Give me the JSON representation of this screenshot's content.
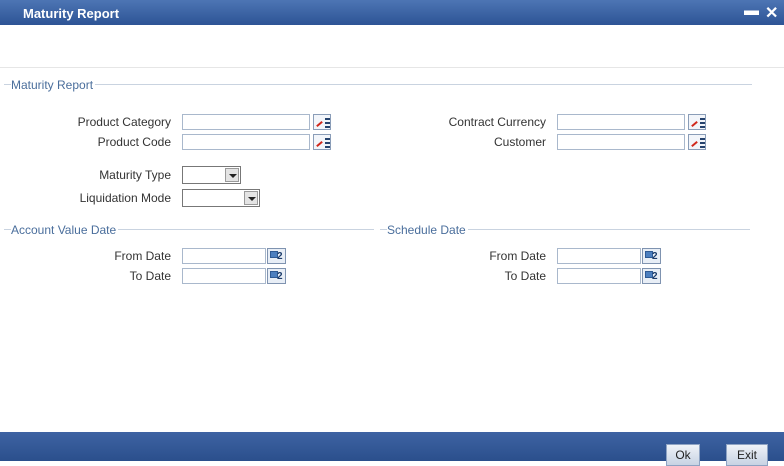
{
  "window": {
    "title": "Maturity Report",
    "minimize_icon": "minimize-icon",
    "close_icon": "close-icon"
  },
  "maturity_report": {
    "section_title": "Maturity Report",
    "product_category": {
      "label": "Product Category",
      "value": ""
    },
    "product_code": {
      "label": "Product Code",
      "value": ""
    },
    "contract_currency": {
      "label": "Contract Currency",
      "value": ""
    },
    "customer": {
      "label": "Customer",
      "value": ""
    },
    "maturity_type": {
      "label": "Maturity Type",
      "selected": ""
    },
    "liquidation_mode": {
      "label": "Liquidation Mode",
      "selected": ""
    }
  },
  "account_value_date": {
    "section_title": "Account Value Date",
    "from_label": "From Date",
    "to_label": "To Date",
    "from_value": "",
    "to_value": ""
  },
  "schedule_date": {
    "section_title": "Schedule Date",
    "from_label": "From Date",
    "to_label": "To Date",
    "from_value": "",
    "to_value": ""
  },
  "calendar_glyph": "2",
  "footer": {
    "ok_label": "Ok",
    "exit_label": "Exit"
  },
  "colors": {
    "titlebar": "#2d5495",
    "section_title": "#4a6e9c",
    "footer": "#2b4f8c"
  }
}
